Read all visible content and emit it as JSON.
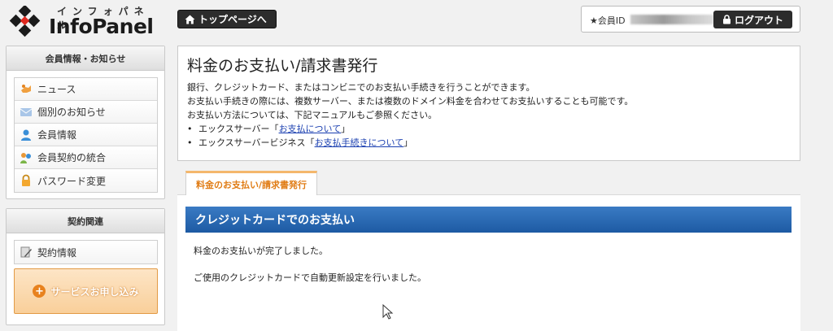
{
  "header": {
    "logo_kana": "インフォパネル",
    "logo_name": "InfoPanel",
    "top_page_button": "トップページへ",
    "member_id_label": "★会員ID",
    "logout_button": "ログアウト"
  },
  "sidebar": {
    "member_panel": {
      "title": "会員情報・お知らせ",
      "items": [
        {
          "label": "ニュース",
          "icon": "news-icon"
        },
        {
          "label": "個別のお知らせ",
          "icon": "notice-icon"
        },
        {
          "label": "会員情報",
          "icon": "member-icon"
        },
        {
          "label": "会員契約の統合",
          "icon": "merge-icon"
        },
        {
          "label": "パスワード変更",
          "icon": "lock-icon"
        }
      ]
    },
    "contract_panel": {
      "title": "契約関連",
      "items": [
        {
          "label": "契約情報",
          "icon": "contract-icon"
        }
      ],
      "service_button": "サービスお申し込み"
    }
  },
  "main": {
    "title": "料金のお支払い/請求書発行",
    "desc1": "銀行、クレジットカード、またはコンビニでのお支払い手続きを行うことができます。",
    "desc2": "お支払い手続きの際には、複数サーバー、または複数のドメイン料金を合わせてお支払いすることも可能です。",
    "desc3": "お支払い方法については、下記マニュアルもご参照ください。",
    "bullets": [
      {
        "prefix": "エックスサーバー「",
        "link": "お支払について",
        "suffix": "」"
      },
      {
        "prefix": "エックスサーバービジネス「",
        "link": "お支払手続きについて",
        "suffix": "」"
      }
    ],
    "tab_label": "料金のお支払い/請求書発行",
    "section_title": "クレジットカードでのお支払い",
    "message1": "料金のお支払いが完了しました。",
    "message2": "ご使用のクレジットカードで自動更新設定を行いました。"
  },
  "colors": {
    "section_bar": "#1d5aa3",
    "tab_accent": "#e07c15",
    "service_button": "#f9cf9a"
  }
}
